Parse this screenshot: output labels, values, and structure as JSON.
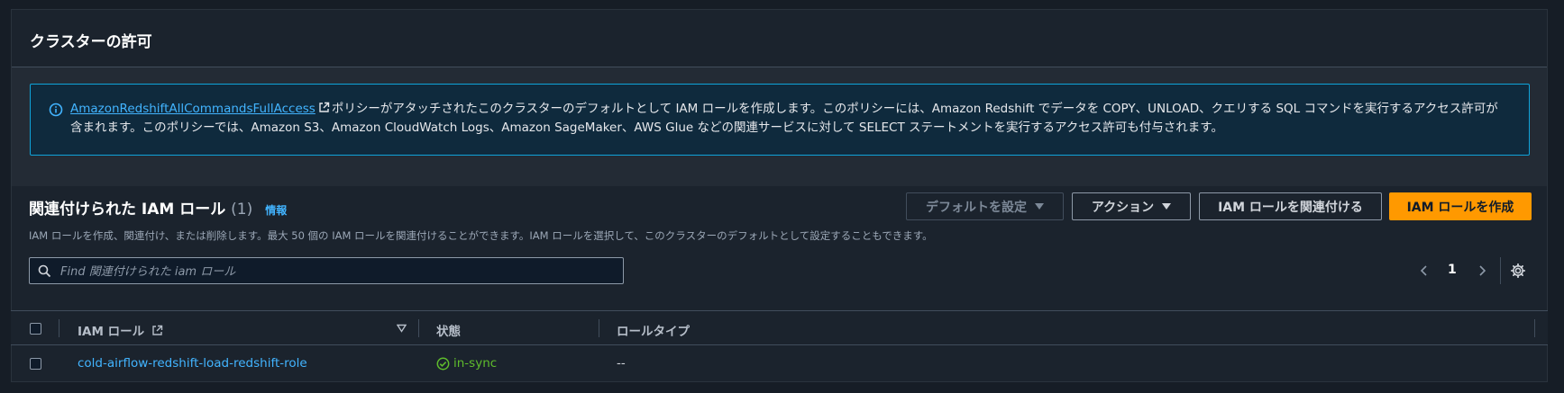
{
  "panel": {
    "title": "クラスターの許可"
  },
  "alert": {
    "link_text": "AmazonRedshiftAllCommandsFullAccess",
    "body_line1": "ポリシーがアタッチされたこのクラスターのデフォルトとして IAM ロールを作成します。このポリシーには、Amazon Redshift でデータを COPY、UNLOAD、クエリする SQL コマンドを実行するアクセス許可が",
    "body_line2": "含まれます。このポリシーでは、Amazon S3、Amazon CloudWatch Logs、Amazon SageMaker、AWS Glue などの関連サービスに対して SELECT ステートメントを実行するアクセス許可も付与されます。"
  },
  "section": {
    "title": "関連付けられた IAM ロール",
    "count": "(1)",
    "info": "情報",
    "description": "IAM ロールを作成、関連付け、または削除します。最大 50 個の IAM ロールを関連付けることができます。IAM ロールを選択して、このクラスターのデフォルトとして設定することもできます。"
  },
  "buttons": {
    "set_default": "デフォルトを設定",
    "actions": "アクション",
    "associate": "IAM ロールを関連付ける",
    "create": "IAM ロールを作成"
  },
  "search": {
    "placeholder": "Find 関連付けられた iam ロール"
  },
  "pagination": {
    "current_page": "1"
  },
  "table": {
    "columns": [
      "IAM ロール",
      "状態",
      "ロールタイプ"
    ],
    "rows": [
      {
        "role": "cold-airflow-redshift-load-redshift-role",
        "status": "in-sync",
        "type": "--"
      }
    ]
  },
  "colors": {
    "accent": "#ff9900",
    "link": "#42b4ff",
    "info_border": "#0fa3d9",
    "success": "#5fbd2c"
  }
}
